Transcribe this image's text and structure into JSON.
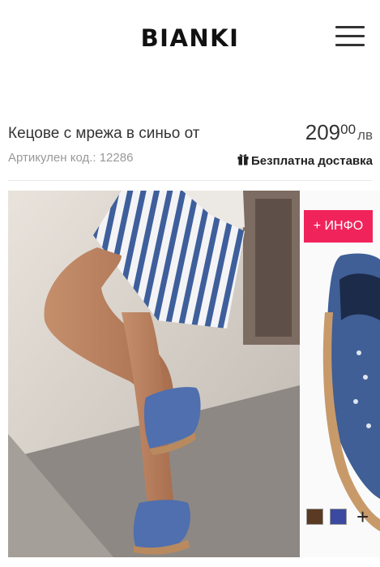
{
  "header": {
    "logo": "BIANKI",
    "menu_icon": "hamburger-icon"
  },
  "product": {
    "title": "Кецове с мрежа в синьо от",
    "price_whole": "209",
    "price_fraction": "00",
    "currency": "лв",
    "sku_label": "Артикулен код.:",
    "sku": "12286",
    "shipping": "Безплатна доставка",
    "shipping_icon": "gift-icon"
  },
  "gallery": {
    "info_button": "+ ИНФО",
    "swatches": [
      {
        "name": "brown",
        "color": "#5a3a22"
      },
      {
        "name": "blue",
        "color": "#3b49a0"
      }
    ],
    "more_colors": "+"
  }
}
